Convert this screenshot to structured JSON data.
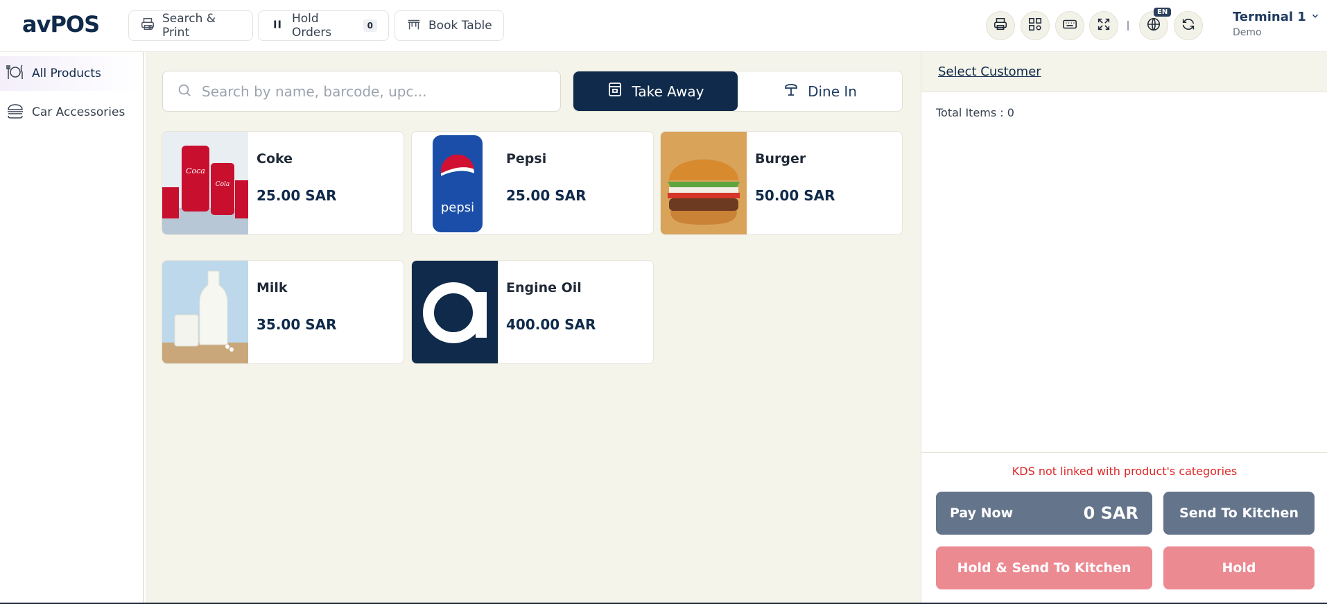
{
  "app": {
    "logo": "avPOS"
  },
  "header": {
    "search_print_label": "Search & Print",
    "hold_orders_label": "Hold Orders",
    "hold_orders_count": "0",
    "book_table_label": "Book Table",
    "language_badge": "EN",
    "terminal_title": "Terminal 1",
    "terminal_subtitle": "Demo",
    "icons": [
      "printer-icon",
      "qr-code-icon",
      "keyboard-icon",
      "fullscreen-icon",
      "globe-icon",
      "refresh-icon"
    ]
  },
  "sidebar": {
    "items": [
      {
        "label": "All Products",
        "icon": "dining-icon",
        "active": true
      },
      {
        "label": "Car Accessories",
        "icon": "burger-icon",
        "active": false
      }
    ]
  },
  "main": {
    "search_placeholder": "Search by name, barcode, upc...",
    "modes": [
      {
        "label": "Take Away",
        "active": true
      },
      {
        "label": "Dine In",
        "active": false
      }
    ],
    "products": [
      {
        "name": "Coke",
        "price": "25.00 SAR"
      },
      {
        "name": "Pepsi",
        "price": "25.00 SAR"
      },
      {
        "name": "Burger",
        "price": "50.00 SAR"
      },
      {
        "name": "Milk",
        "price": "35.00 SAR"
      },
      {
        "name": "Engine Oil",
        "price": "400.00 SAR"
      }
    ]
  },
  "cart": {
    "select_customer": "Select Customer",
    "total_items": "Total Items : 0",
    "kds_warning": "KDS not linked with product's categories",
    "pay_now_label": "Pay Now",
    "pay_amount": "0 SAR",
    "send_to_kitchen": "Send To Kitchen",
    "hold_send_kitchen": "Hold & Send To Kitchen",
    "hold": "Hold"
  },
  "colors": {
    "primary": "#0f2a4a",
    "background": "#f5f4ea",
    "slate_button": "#64748b",
    "rose_button": "#ec8a92",
    "warning_text": "#dc2626"
  }
}
